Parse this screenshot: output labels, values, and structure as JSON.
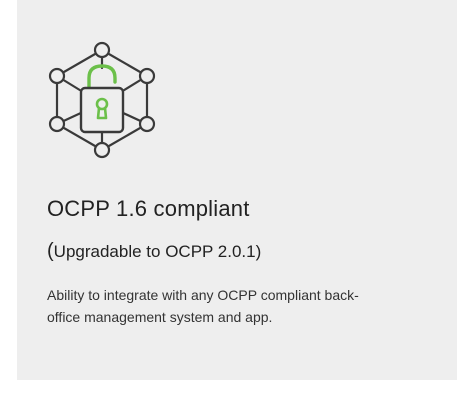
{
  "card": {
    "icon": "network-padlock-icon",
    "title": "OCPP 1.6 compliant",
    "subtitle_open": "(",
    "subtitle": "Upgradable to OCPP 2.0.1)",
    "description": "Ability to integrate with any OCPP compliant back-office management system and app."
  },
  "colors": {
    "background": "#eeeeee",
    "text": "#222222",
    "icon_stroke": "#3a3a3a",
    "icon_accent": "#6cc04a"
  }
}
